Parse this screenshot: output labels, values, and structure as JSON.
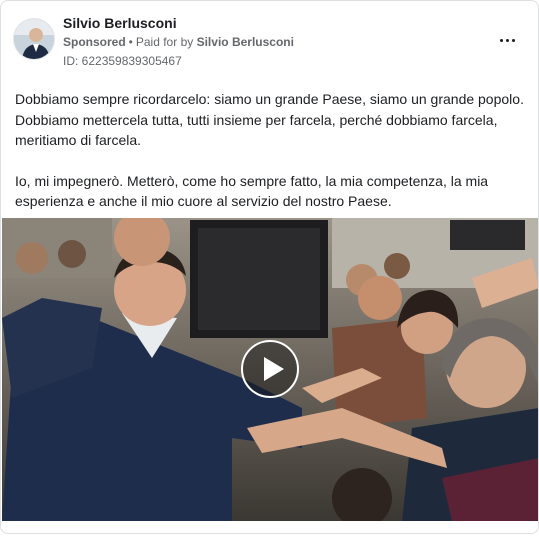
{
  "ad": {
    "page_name": "Silvio Berlusconi",
    "sponsored_label": "Sponsored",
    "separator": "•",
    "paid_for_prefix": "Paid for by",
    "paid_for_name": "Silvio Berlusconi",
    "id_label": "ID: 622359839305467",
    "body": [
      "Dobbiamo sempre ricordarcelo: siamo un grande Paese, siamo un grande popolo. Dobbiamo mettercela tutta, tutti insieme per farcela, perché dobbiamo farcela, meritiamo di farcela.",
      "Io, mi impegnerò. Metterò, come ho sempre fatto, la mia competenza, la mia esperienza e anche il mio cuore al servizio del nostro Paese."
    ]
  },
  "icons": {
    "more": "more-options-icon",
    "play": "play-icon"
  },
  "colors": {
    "text_primary": "#1c1e21",
    "text_secondary": "#65676b",
    "border": "#dddfe2"
  }
}
